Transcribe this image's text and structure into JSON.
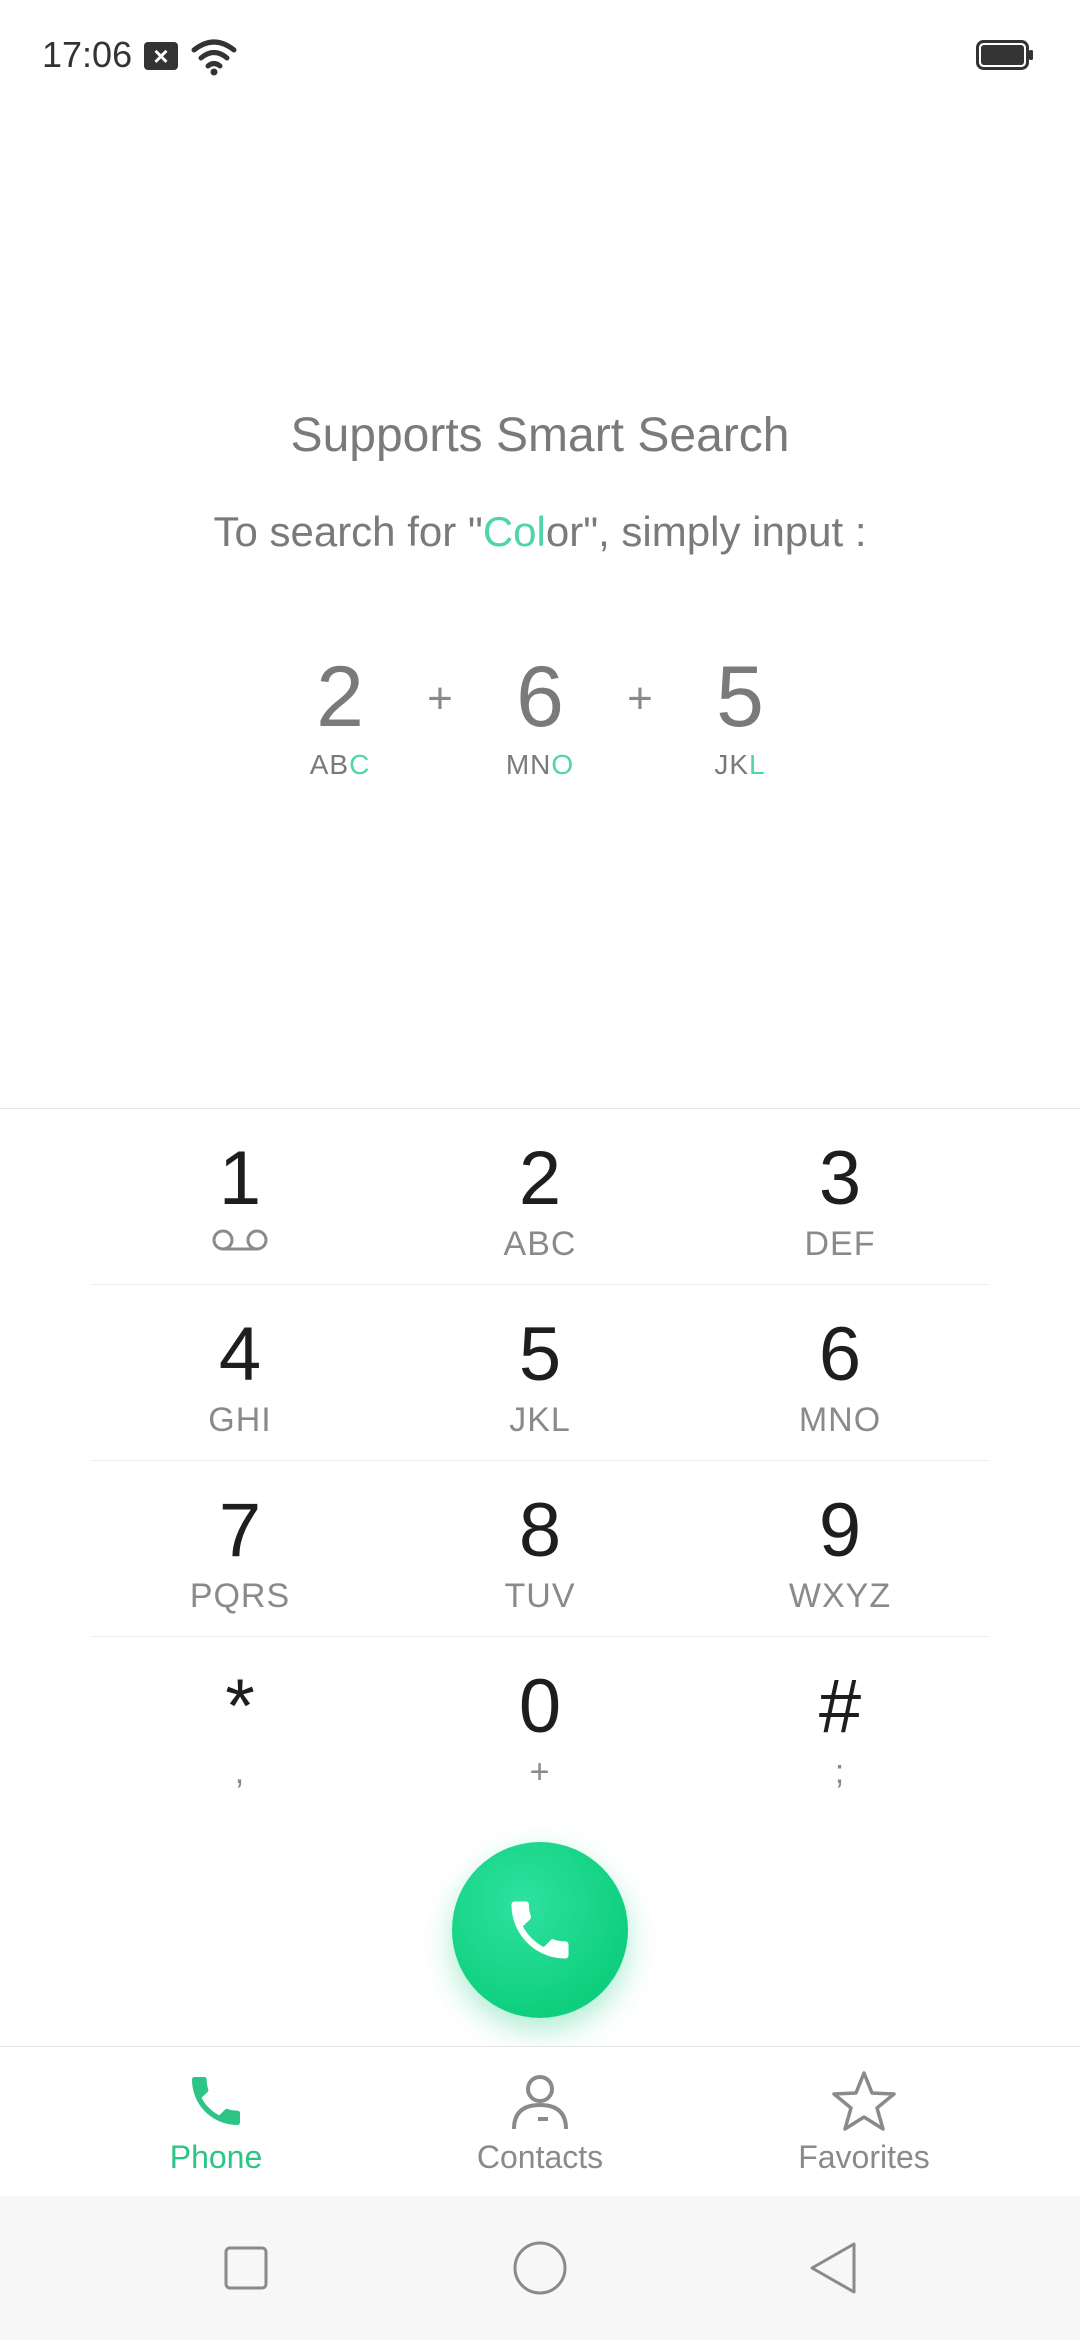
{
  "status_bar": {
    "time": "17:06",
    "notification_icon": "close-box-icon",
    "wifi_icon": "wifi-icon",
    "battery_icon": "battery-icon"
  },
  "hint": {
    "title": "Supports Smart Search",
    "subtitle_prefix": "To search for \"",
    "subtitle_highlight": "Col",
    "subtitle_rest": "or\", simply input :",
    "example": [
      {
        "digit": "2",
        "letters_plain": "AB",
        "letters_highlight": "C"
      },
      {
        "digit": "6",
        "letters_plain": "MN",
        "letters_highlight": "O"
      },
      {
        "digit": "5",
        "letters_plain": "JK",
        "letters_highlight": "L"
      }
    ],
    "plus": "+"
  },
  "keypad": {
    "keys": [
      {
        "digit": "1",
        "letters": "",
        "icon": "voicemail-icon"
      },
      {
        "digit": "2",
        "letters": "ABC"
      },
      {
        "digit": "3",
        "letters": "DEF"
      },
      {
        "digit": "4",
        "letters": "GHI"
      },
      {
        "digit": "5",
        "letters": "JKL"
      },
      {
        "digit": "6",
        "letters": "MNO"
      },
      {
        "digit": "7",
        "letters": "PQRS"
      },
      {
        "digit": "8",
        "letters": "TUV"
      },
      {
        "digit": "9",
        "letters": "WXYZ"
      },
      {
        "digit": "*",
        "letters": ","
      },
      {
        "digit": "0",
        "letters": "+"
      },
      {
        "digit": "#",
        "letters": ";"
      }
    ]
  },
  "call_button": {
    "icon": "phone-icon",
    "color": "#14d487"
  },
  "tabs": [
    {
      "label": "Phone",
      "icon": "phone-icon",
      "active": true
    },
    {
      "label": "Contacts",
      "icon": "person-icon",
      "active": false
    },
    {
      "label": "Favorites",
      "icon": "star-icon",
      "active": false
    }
  ],
  "colors": {
    "accent": "#2cc586",
    "highlight": "#4fd6a6"
  },
  "nav_bar": {
    "buttons": [
      "square-icon",
      "circle-icon",
      "triangle-back-icon"
    ]
  }
}
